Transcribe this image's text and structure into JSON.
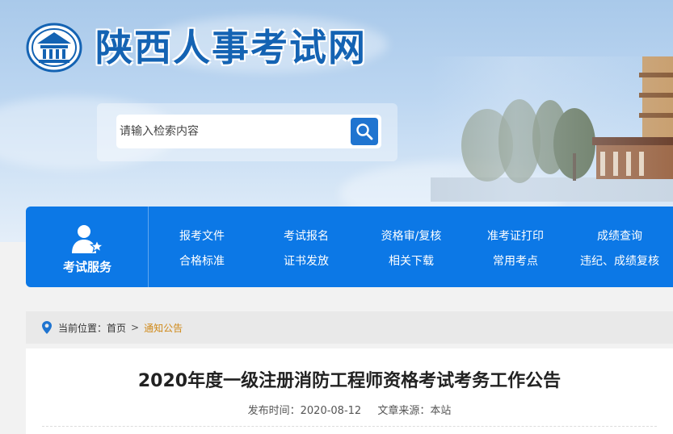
{
  "site": {
    "title": "陕西人事考试网"
  },
  "search": {
    "placeholder": "请输入检索内容"
  },
  "nav": {
    "brand_label": "考试服务",
    "links": [
      "报考文件",
      "考试报名",
      "资格审/复核",
      "准考证打印",
      "成绩查询",
      "合格标准",
      "证书发放",
      "相关下载",
      "常用考点",
      "违纪、成绩复核"
    ]
  },
  "breadcrumb": {
    "label": "当前位置：",
    "home": "首页",
    "separator": ">",
    "current": "通知公告"
  },
  "article": {
    "title": "2020年度一级注册消防工程师资格考试考务工作公告",
    "publish_time": "发布时间：2020-08-12",
    "source": "文章来源：本站"
  },
  "colors": {
    "brand_blue": "#0c78e6",
    "title_blue": "#1463b3",
    "breadcrumb_current": "#d08a1a"
  },
  "icons": {
    "logo": "building-emblem-icon",
    "search": "search-icon",
    "brand": "user-star-icon",
    "location": "location-pin-icon"
  }
}
